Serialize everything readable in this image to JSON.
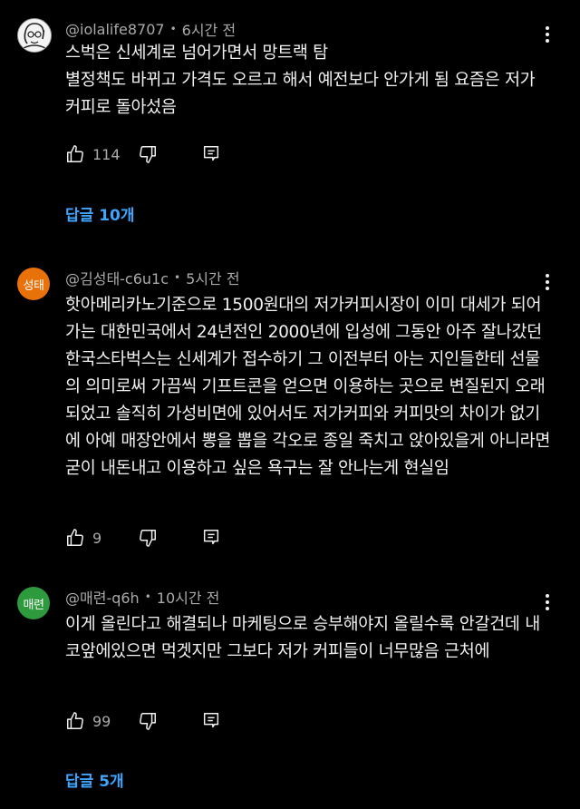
{
  "colors": {
    "background": "#000000",
    "text": "#f1f1f1",
    "meta": "#aaaaaa",
    "link": "#3ea6ff",
    "avatar_orange": "#e8710a",
    "avatar_green": "#2e9a3e"
  },
  "comments": [
    {
      "author": "@iolalife8707",
      "time": "6시간 전",
      "avatar_text": "",
      "avatar_icon": "illustrated-face-avatar",
      "text": "스벅은 신세계로 넘어가면서 망트랙 탐\n별정책도 바뀌고 가격도 오르고 해서 예전보다 안가게 됨 요즘은 저가 커피로 돌아섰음",
      "likes": "114",
      "replies_label": "답글 10개"
    },
    {
      "author": "@김성태-c6u1c",
      "time": "5시간 전",
      "avatar_text": "성태",
      "text": "핫아메리카노기준으로 1500원대의 저가커피시장이 이미 대세가 되어가는 대한민국에서 24년전인 2000년에 입성에 그동안 아주 잘나갔던 한국스타벅스는 신세계가 접수하기 그 이전부터 아는 지인들한테 선물의 의미로써 가끔씩 기프트콘을 얻으면 이용하는 곳으로 변질된지 오래되었고 솔직히 가성비면에 있어서도 저가커피와 커피맛의 차이가 없기에 아예 매장안에서 뽕을 뽑을 각오로 종일 죽치고 앉아있을게 아니라면 굳이 내돈내고 이용하고 싶은 욕구는 잘 안나는게 현실임",
      "likes": "9"
    },
    {
      "author": "@매련-q6h",
      "time": "10시간 전",
      "avatar_text": "매련",
      "text": "이게 올린다고 해결되나  마케팅으로 승부해야지  올릴수록 안갈건데  내 코앞에있으면 먹겟지만  그보다  저가 커피들이 너무많음 근처에",
      "likes": "99",
      "replies_label": "답글 5개"
    }
  ]
}
